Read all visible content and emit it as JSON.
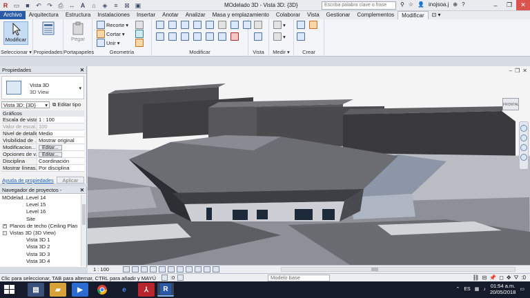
{
  "app": {
    "doc_title": "MOdelado 3D - Vista 3D: {3D}",
    "search_placeholder": "Escriba palabra clave o frase",
    "user": "inojsoa.j"
  },
  "tabs": [
    "Archivo",
    "Arquitectura",
    "Estructura",
    "Instalaciones",
    "Insertar",
    "Anotar",
    "Analizar",
    "Masa y emplazamiento",
    "Colaborar",
    "Vista",
    "Gestionar",
    "Complementos",
    "Modificar"
  ],
  "ribbon": {
    "groups": {
      "select": "Seleccionar",
      "properties": "Propiedades",
      "clipboard": "Portapapeles",
      "geometry": "Geometría",
      "modify": "Modificar",
      "view": "Vista",
      "measure": "Medir",
      "create": "Crear"
    },
    "modify_button": "Modificar",
    "properties_button": "Propiedades",
    "paste_button": "Pegar",
    "cope_label": "Recorte",
    "cut_label": "Cortar",
    "join_label": "Unir"
  },
  "properties_panel": {
    "title": "Propiedades",
    "type_line1": "Vista 3D",
    "type_line2": "3D View",
    "view_select": "Vista 3D: {3D}",
    "edit_type": "Editar tipo",
    "group_graphics": "Gráficos",
    "rows": [
      {
        "k": "Escala de vista",
        "v": "1 : 100"
      },
      {
        "k": "Valor de escal...",
        "v": "100"
      },
      {
        "k": "Nivel de detalle",
        "v": "Medio"
      },
      {
        "k": "Visibilidad de ...",
        "v": "Mostrar original"
      },
      {
        "k": "Modificacion...",
        "v": "Editar..."
      },
      {
        "k": "Opciones de v...",
        "v": "Editar..."
      },
      {
        "k": "Disciplina",
        "v": "Coordinación"
      },
      {
        "k": "Mostrar líneas...",
        "v": "Por disciplina"
      }
    ],
    "help_link": "Ayuda de propiedades",
    "apply_button": "Aplicar"
  },
  "project_browser": {
    "title": "Navegador de proyectos - MOdelad...",
    "items": [
      {
        "label": "Level 14",
        "indent": 3
      },
      {
        "label": "Level 15",
        "indent": 3
      },
      {
        "label": "Level 16",
        "indent": 3
      },
      {
        "label": "Site",
        "indent": 3
      },
      {
        "label": "Planos de techo (Ceiling Plan",
        "indent": 1,
        "exp": "+"
      },
      {
        "label": "Vistas 3D (3D View)",
        "indent": 1,
        "exp": "-"
      },
      {
        "label": "Vista 3D 1",
        "indent": 3
      },
      {
        "label": "Vista 3D 2",
        "indent": 3
      },
      {
        "label": "Vista 3D 3",
        "indent": 3
      },
      {
        "label": "Vista 3D 4",
        "indent": 3
      }
    ]
  },
  "viewport": {
    "view_cube_label": "FRONTAL",
    "scale": "1 : 100"
  },
  "status": {
    "text": "Clic para seleccionar, TAB para alternar, CTRL para añadir y MAYÚ",
    "zero": ":0",
    "model": "Modelo base",
    "filter_count": ":0"
  },
  "taskbar": {
    "language": "ES",
    "time": "01:54 a.m.",
    "date": "20/05/2018"
  },
  "colors": {
    "file_tab": "#2b5aa6",
    "selection": "#c6dcf5"
  }
}
